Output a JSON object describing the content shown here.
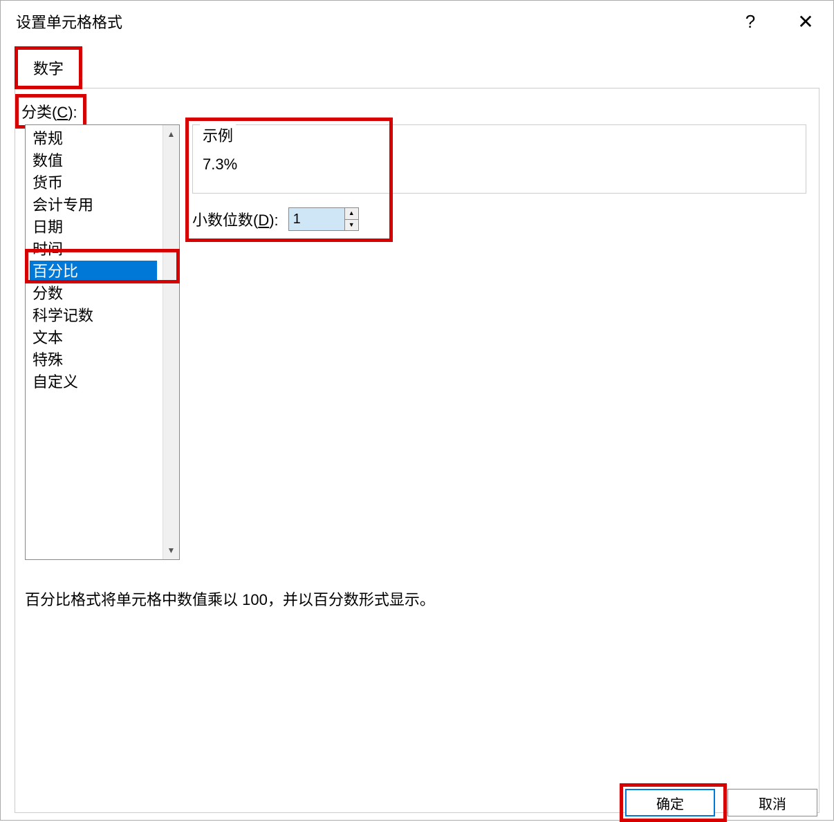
{
  "dialog": {
    "title": "设置单元格格式"
  },
  "tabs": {
    "number": "数字"
  },
  "category": {
    "label_prefix": "分类(",
    "label_key": "C",
    "label_suffix": "):",
    "items": [
      "常规",
      "数值",
      "货币",
      "会计专用",
      "日期",
      "时间",
      "百分比",
      "分数",
      "科学记数",
      "文本",
      "特殊",
      "自定义"
    ],
    "selected_index": 6
  },
  "sample": {
    "label": "示例",
    "value": "7.3%"
  },
  "decimal": {
    "label_prefix": "小数位数(",
    "label_key": "D",
    "label_suffix": "):",
    "value": "1"
  },
  "description": "百分比格式将单元格中数值乘以 100，并以百分数形式显示。",
  "buttons": {
    "ok": "确定",
    "cancel": "取消"
  }
}
